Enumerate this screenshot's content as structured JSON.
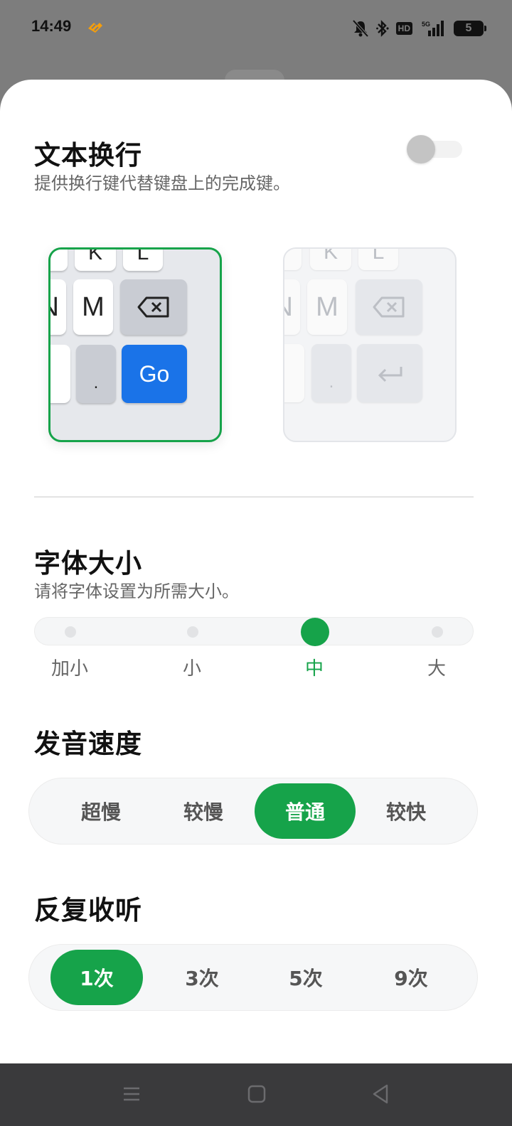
{
  "status_bar": {
    "time": "14:49",
    "hd_label": "HD",
    "network_label": "5G",
    "battery_level": "5"
  },
  "text_wrap": {
    "title": "文本换行",
    "description": "提供换行键代替键盘上的完成键。",
    "toggle_on": false
  },
  "keyboard_preview_go": {
    "top_keys": [
      "K",
      "L"
    ],
    "middle_keys": [
      "N",
      "M"
    ],
    "period_key": ".",
    "action_key": "Go"
  },
  "keyboard_preview_enter": {
    "top_keys": [
      "K",
      "L"
    ],
    "middle_keys": [
      "N",
      "M"
    ],
    "period_key": "."
  },
  "font_size": {
    "title": "字体大小",
    "description": "请将字体设置为所需大小。",
    "options": [
      "加小",
      "小",
      "中",
      "大"
    ],
    "selected": "中"
  },
  "speech_rate": {
    "title": "发音速度",
    "options": [
      "超慢",
      "较慢",
      "普通",
      "较快"
    ],
    "selected": "普通"
  },
  "repeat_listen": {
    "title": "反复收听",
    "options": [
      "1次",
      "3次",
      "5次",
      "9次"
    ],
    "selected": "1次"
  },
  "colors": {
    "accent_green": "#16a34a",
    "go_key_blue": "#1a73e8"
  }
}
